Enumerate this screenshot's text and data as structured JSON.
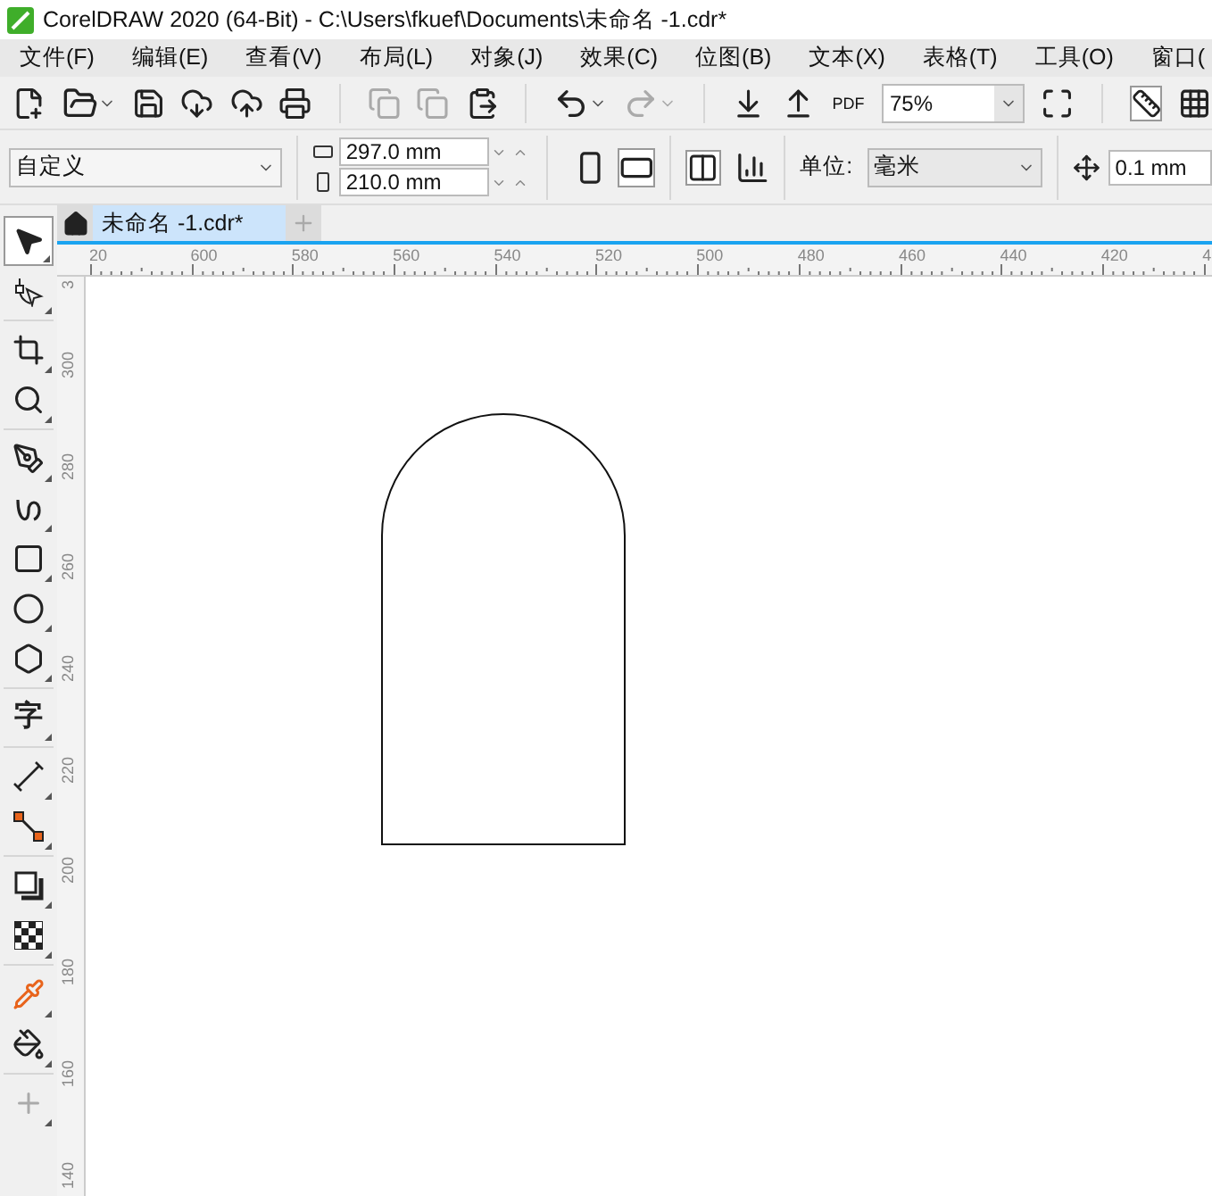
{
  "window": {
    "title": "CorelDRAW 2020 (64-Bit) - C:\\Users\\fkuef\\Documents\\未命名 -1.cdr*"
  },
  "menu": [
    "文件(F)",
    "编辑(E)",
    "查看(V)",
    "布局(L)",
    "对象(J)",
    "效果(C)",
    "位图(B)",
    "文本(X)",
    "表格(T)",
    "工具(O)",
    "窗口("
  ],
  "toolbar": {
    "pdf_label": "PDF",
    "zoom": "75%"
  },
  "property_bar": {
    "preset": "自定义",
    "width": "297.0 mm",
    "height": "210.0 mm",
    "unit_label": "单位:",
    "unit": "毫米",
    "nudge": "0.1 mm"
  },
  "tabs": [
    {
      "label": "未命名 -1.cdr*",
      "selected": true
    }
  ],
  "toolbox": [
    [
      {
        "kind": "pick",
        "selected": true
      },
      {
        "kind": "shape",
        "selected": false
      }
    ],
    [
      {
        "kind": "crop",
        "selected": false
      },
      {
        "kind": "zoom",
        "selected": false
      }
    ],
    [
      {
        "kind": "pen",
        "selected": false
      },
      {
        "kind": "spiral",
        "selected": false
      },
      {
        "kind": "rectangle",
        "selected": false
      },
      {
        "kind": "ellipse",
        "selected": false
      },
      {
        "kind": "polygon",
        "selected": false
      }
    ],
    [
      {
        "kind": "text",
        "glyph": "字",
        "selected": false
      }
    ],
    [
      {
        "kind": "dimension",
        "selected": false
      },
      {
        "kind": "connector",
        "selected": false
      }
    ],
    [
      {
        "kind": "shadow",
        "selected": false
      },
      {
        "kind": "transparency",
        "selected": false
      }
    ],
    [
      {
        "kind": "eyedropper",
        "selected": false
      },
      {
        "kind": "fill",
        "selected": false
      }
    ],
    [
      {
        "kind": "add",
        "selected": false
      }
    ]
  ],
  "ruler_h": [
    "20",
    "600",
    "580",
    "560",
    "540",
    "520",
    "500",
    "480",
    "460",
    "440",
    "420",
    "4"
  ],
  "ruler_v": [
    "3",
    "300",
    "280",
    "260",
    "240",
    "220",
    "200",
    "180",
    "160",
    "140"
  ]
}
